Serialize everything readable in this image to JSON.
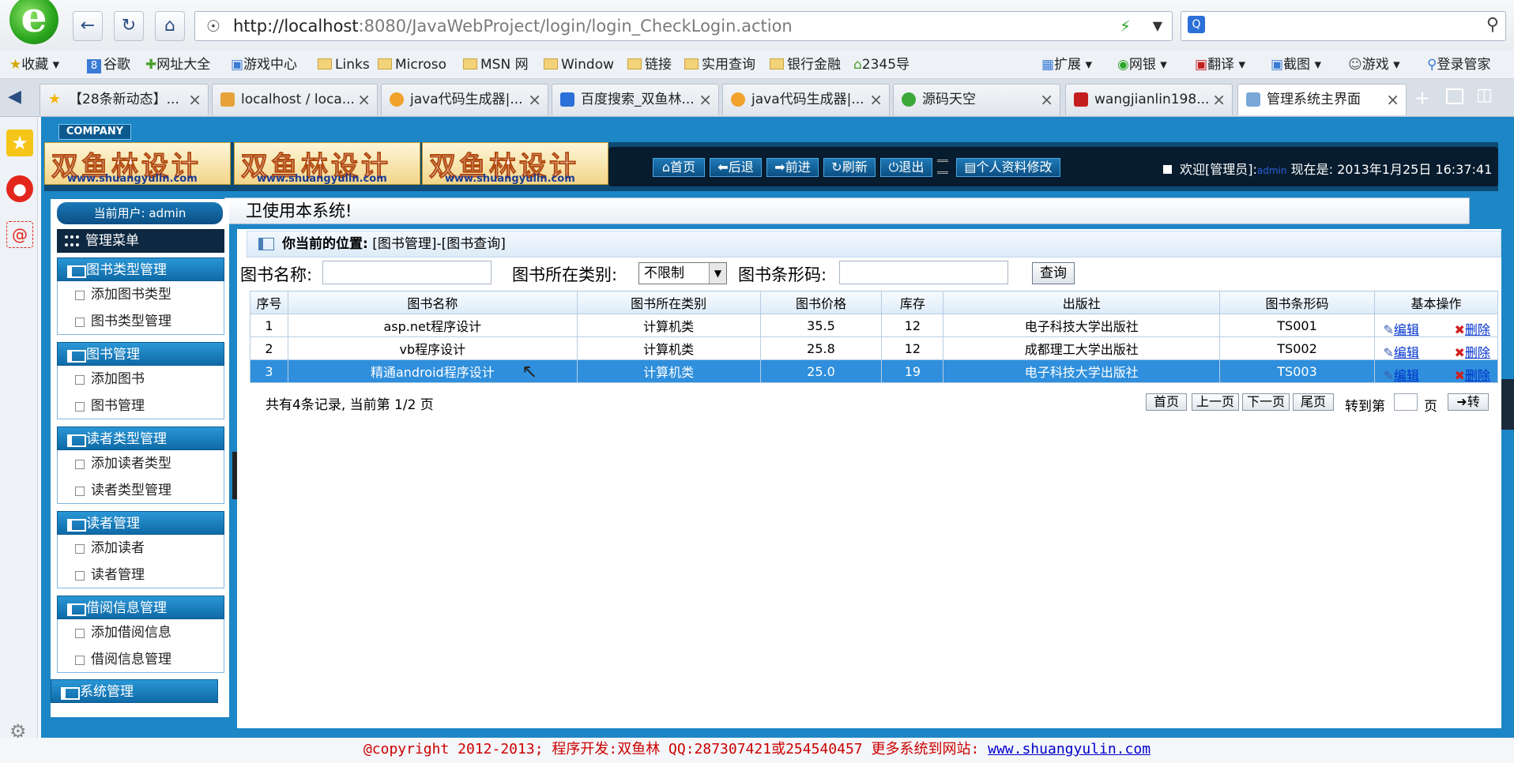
{
  "browser": {
    "url_host": "http://localhost",
    "url_rest": ":8080/JavaWebProject/login/login_CheckLogin.action",
    "favorites": [
      "收藏",
      "谷歌",
      "网址大全",
      "游戏中心",
      "Links",
      "Microso",
      "MSN 网",
      "Window",
      "链接",
      "实用查询",
      "银行金融",
      "2345导"
    ],
    "right_tools": [
      "扩展",
      "网银",
      "翻译",
      "截图",
      "游戏",
      "登录管家"
    ],
    "tabs": [
      {
        "label": "【28条新动态】...",
        "color": "#f5b400"
      },
      {
        "label": "localhost / loca...",
        "color": "#e7a33a"
      },
      {
        "label": "java代码生成器|...",
        "color": "#f0a22c"
      },
      {
        "label": "百度搜索_双鱼林...",
        "color": "#2b6fd8"
      },
      {
        "label": "java代码生成器|...",
        "color": "#f0a22c"
      },
      {
        "label": "源码天空",
        "color": "#3aa83a"
      },
      {
        "label": "wangjianlin198...",
        "color": "#c41f1f"
      },
      {
        "label": "管理系统主界面",
        "color": "#7aa7d8"
      }
    ]
  },
  "header": {
    "company": "COMPANY",
    "brand_name": "双鱼林设计",
    "brand_url": "www.shuangyulin.com",
    "nav": [
      "首页",
      "后退",
      "前进",
      "刷新",
      "退出",
      "个人资料修改"
    ],
    "welcome_prefix": "欢迎[管理员]:",
    "welcome_user": "admin",
    "welcome_time": "现在是: 2013年1月25日 16:37:41"
  },
  "marquee": "卫使用本系统!",
  "sidebar": {
    "current_user": "当前用户: admin",
    "menu_title": "管理菜单",
    "groups": [
      {
        "title": "图书类型管理",
        "items": [
          "添加图书类型",
          "图书类型管理"
        ]
      },
      {
        "title": "图书管理",
        "items": [
          "添加图书",
          "图书管理"
        ]
      },
      {
        "title": "读者类型管理",
        "items": [
          "添加读者类型",
          "读者类型管理"
        ]
      },
      {
        "title": "读者管理",
        "items": [
          "添加读者",
          "读者管理"
        ]
      },
      {
        "title": "借阅信息管理",
        "items": [
          "添加借阅信息",
          "借阅信息管理"
        ]
      },
      {
        "title": "系统管理",
        "items": []
      }
    ]
  },
  "breadcrumb": {
    "label": "你当前的位置:",
    "path": "[图书管理]-[图书查询]"
  },
  "filter": {
    "name_label": "图书名称:",
    "category_label": "图书所在类别:",
    "category_value": "不限制",
    "barcode_label": "图书条形码:",
    "query_label": "查询"
  },
  "table": {
    "headers": [
      "序号",
      "图书名称",
      "图书所在类别",
      "图书价格",
      "库存",
      "出版社",
      "图书条形码",
      "基本操作"
    ],
    "rows": [
      [
        "1",
        "asp.net程序设计",
        "计算机类",
        "35.5",
        "12",
        "电子科技大学出版社",
        "TS001"
      ],
      [
        "2",
        "vb程序设计",
        "计算机类",
        "25.8",
        "12",
        "成都理工大学出版社",
        "TS002"
      ],
      [
        "3",
        "精通android程序设计",
        "计算机类",
        "25.0",
        "19",
        "电子科技大学出版社",
        "TS003"
      ]
    ],
    "edit_label": "编辑",
    "delete_label": "删除"
  },
  "pagination": {
    "summary": "共有4条记录, 当前第 1/2 页",
    "first": "首页",
    "prev": "上一页",
    "next": "下一页",
    "last": "尾页",
    "goto_label": "转到第",
    "page_unit": "页",
    "go": "➜转"
  },
  "footer": {
    "text": "@copyright 2012-2013; 程序开发:双鱼林  QQ:287307421或254540457  更多系统到网站: ",
    "link": "www.shuangyulin.com"
  }
}
